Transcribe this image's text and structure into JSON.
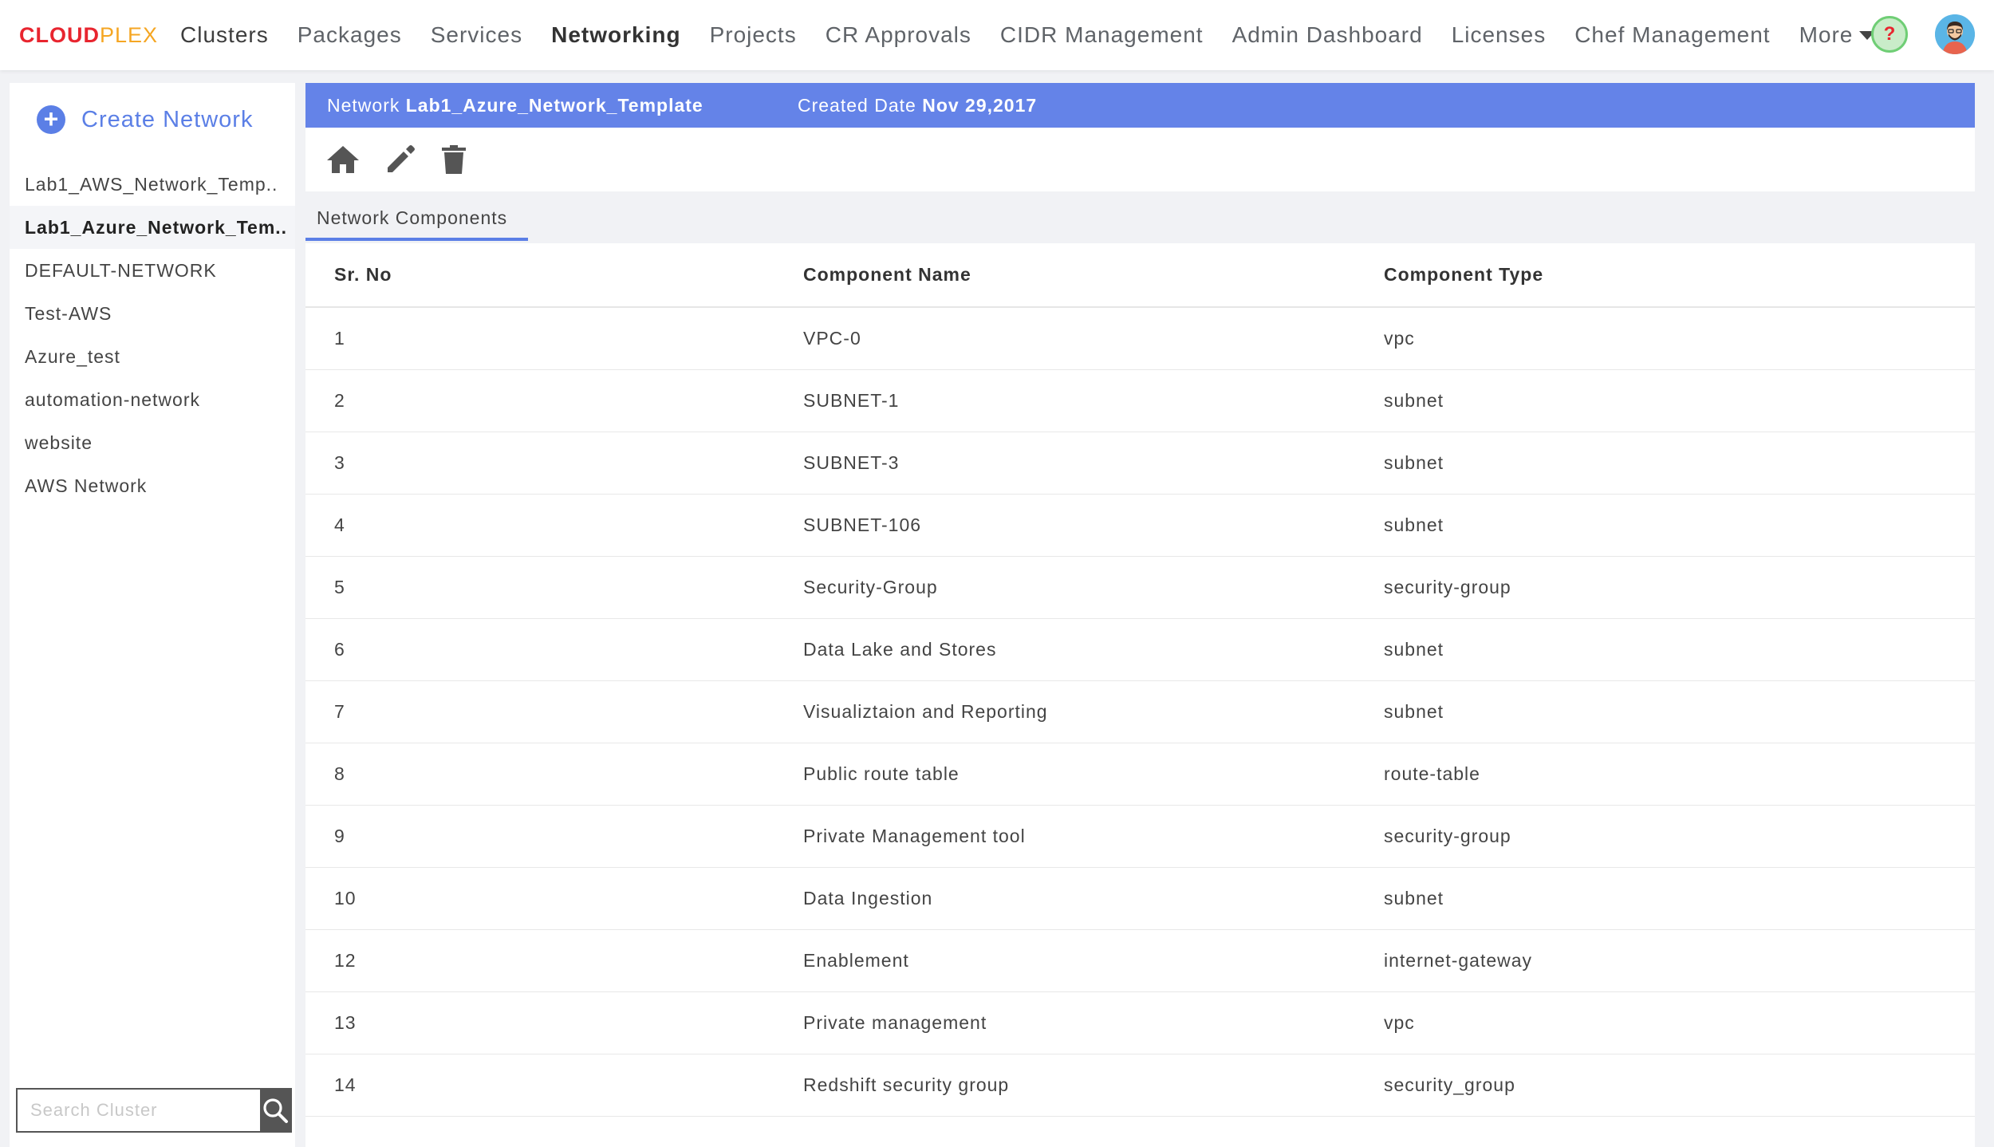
{
  "brand": {
    "part1": "CLOUD",
    "part2": "PLEX"
  },
  "nav": {
    "items": [
      "Clusters",
      "Packages",
      "Services",
      "Networking",
      "Projects",
      "CR Approvals",
      "CIDR Management",
      "Admin Dashboard",
      "Licenses",
      "Chef Management"
    ],
    "active": "Networking",
    "more_label": "More",
    "help_glyph": "?"
  },
  "sidebar": {
    "create_label": "Create Network",
    "networks": [
      "Lab1_AWS_Network_Temp..",
      "Lab1_Azure_Network_Tem..",
      "DEFAULT-NETWORK",
      "Test-AWS",
      "Azure_test",
      "automation-network",
      "website",
      "AWS Network"
    ],
    "selected_index": 1,
    "search_placeholder": "Search Cluster"
  },
  "header": {
    "network_label": "Network",
    "network_name": "Lab1_Azure_Network_Template",
    "created_label": "Created Date",
    "created_date": "Nov 29,2017"
  },
  "toolbar": {
    "icons": [
      "home-icon",
      "edit-icon",
      "delete-icon"
    ]
  },
  "tabs": [
    {
      "label": "Network Components",
      "active": true
    }
  ],
  "table": {
    "columns": [
      "Sr. No",
      "Component Name",
      "Component Type"
    ],
    "rows": [
      [
        "1",
        "VPC-0",
        "vpc"
      ],
      [
        "2",
        "SUBNET-1",
        "subnet"
      ],
      [
        "3",
        "SUBNET-3",
        "subnet"
      ],
      [
        "4",
        "SUBNET-106",
        "subnet"
      ],
      [
        "5",
        "Security-Group",
        "security-group"
      ],
      [
        "6",
        "Data Lake and Stores",
        "subnet"
      ],
      [
        "7",
        "Visualiztaion and Reporting",
        "subnet"
      ],
      [
        "8",
        "Public route table",
        "route-table"
      ],
      [
        "9",
        "Private Management tool",
        "security-group"
      ],
      [
        "10",
        "Data Ingestion",
        "subnet"
      ],
      [
        "12",
        "Enablement",
        "internet-gateway"
      ],
      [
        "13",
        "Private management",
        "vpc"
      ],
      [
        "14",
        "Redshift security group",
        "security_group"
      ]
    ]
  },
  "colors": {
    "accent": "#6483e8",
    "brand_red": "#e8252f",
    "brand_orange": "#f5a623"
  }
}
